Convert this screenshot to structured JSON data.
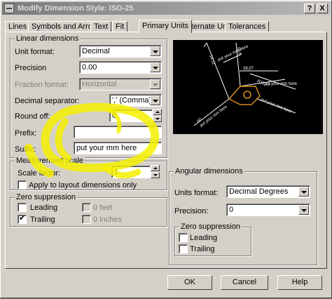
{
  "window": {
    "title": "Modify Dimension Style: ISO-25",
    "help_label": "?",
    "close_label": "X"
  },
  "tabs": [
    {
      "label": "Lines"
    },
    {
      "label": "Symbols and Arrows"
    },
    {
      "label": "Text"
    },
    {
      "label": "Fit"
    },
    {
      "label": "Primary Units"
    },
    {
      "label": "Alternate Units"
    },
    {
      "label": "Tolerances"
    }
  ],
  "active_tab": "Primary Units",
  "linear": {
    "group_label": "Linear dimensions",
    "unit_format": {
      "label": "Unit format:",
      "value": "Decimal"
    },
    "precision": {
      "label": "Precision",
      "value": "0.00"
    },
    "fraction_format": {
      "label": "Fraction format:",
      "value": "Horizontal"
    },
    "decimal_separator": {
      "label": "Decimal separator:",
      "value": "',' (Comma)"
    },
    "round_off": {
      "label": "Round off:",
      "value": "0"
    },
    "prefix": {
      "label": "Prefix:",
      "value": ""
    },
    "suffix": {
      "label": "Suffix:",
      "value": "put your mm here"
    }
  },
  "measurement": {
    "group_label": "Measurement scale",
    "scale_factor": {
      "label": "Scale factor:",
      "value": "1"
    },
    "apply_layout": {
      "label": "Apply to layout dimensions only",
      "checked": false
    }
  },
  "zero_suppression": {
    "group_label": "Zero suppression",
    "leading": {
      "label": "Leading",
      "checked": false
    },
    "trailing": {
      "label": "Trailing",
      "checked": true
    },
    "feet": {
      "label": "0 feet",
      "checked": false,
      "enabled": false
    },
    "inches": {
      "label": "0 inches",
      "checked": false,
      "enabled": false
    }
  },
  "angular": {
    "group_label": "Angular dimensions",
    "units_format": {
      "label": "Units format:",
      "value": "Decimal Degrees"
    },
    "precision": {
      "label": "Precision:",
      "value": "0"
    },
    "zero_suppression": {
      "group_label": "Zero suppression",
      "leading": {
        "label": "Leading",
        "checked": false
      },
      "trailing": {
        "label": "Trailing",
        "checked": false
      }
    }
  },
  "preview": {
    "texts": [
      "14,11",
      "16,6",
      "28,07",
      "R11,17",
      "60"
    ],
    "suffix_text": "put your mm here",
    "colors": {
      "background": "#000000",
      "lines": "#ffffff",
      "shape": "#d98c1a"
    }
  },
  "buttons": {
    "ok": "OK",
    "cancel": "Cancel",
    "help": "Help"
  },
  "annotation": {
    "color": "#f5f000"
  }
}
